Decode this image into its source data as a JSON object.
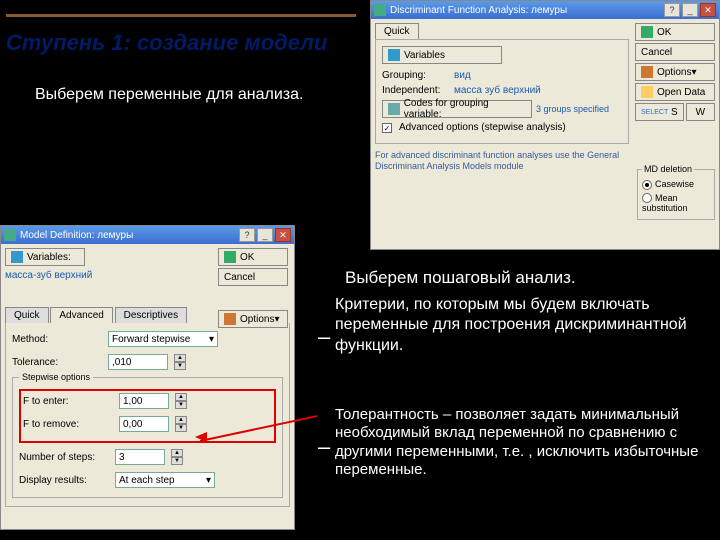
{
  "slide": {
    "title": "Ступень 1: создание модели",
    "text1": "Выберем переменные для анализа.",
    "text2": "Выберем пошаговый анализ.",
    "text3": "Критерии, по которым мы будем включать переменные для построения дискриминантной функции.",
    "text4": "Толерантность – позволяет задать минимальный необходимый вклад переменной по сравнению  с другими переменными, т.е. , исключить избыточные переменные."
  },
  "dlg1": {
    "title": "Discriminant Function Analysis: лемуры",
    "tab_quick": "Quick",
    "btn_variables": "Variables",
    "lbl_grouping": "Grouping:",
    "val_grouping": "вид",
    "lbl_independent": "Independent:",
    "val_independent": "масса зуб верхний",
    "btn_codes": "Codes for grouping variable:",
    "val_codes": "3 groups specified",
    "chk_adv": "Advanced options (stepwise analysis)",
    "note": "For advanced discriminant function analyses use the General Discriminant Analysis Models module",
    "btn_ok": "OK",
    "btn_cancel": "Cancel",
    "btn_options": "Options",
    "btn_opendata": "Open Data",
    "lbl_s": "S",
    "lbl_w": "W",
    "md_title": "MD deletion",
    "md_casewise": "Casewise",
    "md_mean": "Mean substitution"
  },
  "dlg2": {
    "title": "Model Definition: лемуры",
    "btn_variables": "Variables:",
    "val_variables": "масса-зуб верхний",
    "btn_ok": "OK",
    "btn_cancel": "Cancel",
    "btn_options": "Options",
    "tab_quick": "Quick",
    "tab_advanced": "Advanced",
    "tab_desc": "Descriptives",
    "lbl_method": "Method:",
    "val_method": "Forward stepwise",
    "lbl_tolerance": "Tolerance:",
    "val_tolerance": ",010",
    "step_title": "Stepwise options",
    "lbl_fenter": "F to enter:",
    "val_fenter": "1,00",
    "lbl_fremove": "F to remove:",
    "val_fremove": "0,00",
    "lbl_steps": "Number of steps:",
    "val_steps": "3",
    "lbl_display": "Display results:",
    "val_display": "At each step"
  }
}
